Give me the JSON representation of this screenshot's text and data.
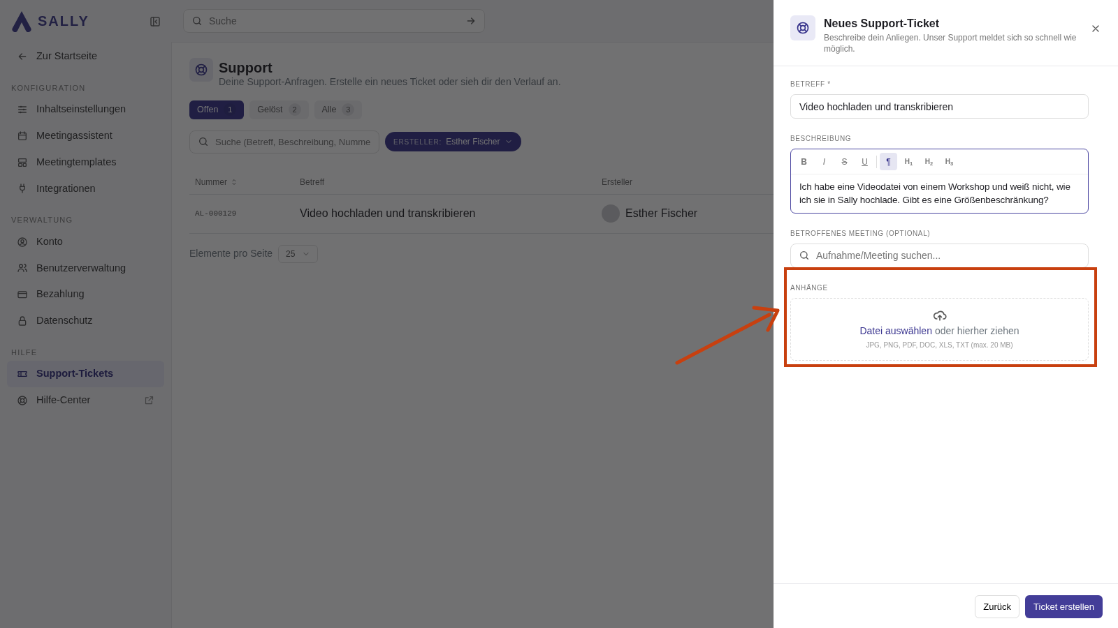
{
  "app": {
    "logo": "SALLY"
  },
  "top_search": {
    "placeholder": "Suche"
  },
  "sidebar": {
    "back_link": "Zur Startseite",
    "sections": [
      {
        "title": "KONFIGURATION",
        "items": [
          {
            "label": "Inhaltseinstellungen",
            "selected": false
          },
          {
            "label": "Meetingassistent",
            "selected": false
          },
          {
            "label": "Meetingtemplates",
            "selected": false
          },
          {
            "label": "Integrationen",
            "selected": false
          }
        ]
      },
      {
        "title": "VERWALTUNG",
        "items": [
          {
            "label": "Konto",
            "selected": false
          },
          {
            "label": "Benutzerverwaltung",
            "selected": false
          },
          {
            "label": "Bezahlung",
            "selected": false
          },
          {
            "label": "Datenschutz",
            "selected": false
          }
        ]
      },
      {
        "title": "HILFE",
        "items": [
          {
            "label": "Support-Tickets",
            "selected": true
          },
          {
            "label": "Hilfe-Center",
            "selected": false,
            "external": true
          }
        ]
      }
    ]
  },
  "page": {
    "title": "Support",
    "subtitle": "Deine Support-Anfragen. Erstelle ein neues Ticket oder sieh dir den Verlauf an.",
    "tabs": [
      {
        "label": "Offen",
        "count": "1",
        "selected": true
      },
      {
        "label": "Gelöst",
        "count": "2",
        "selected": false
      },
      {
        "label": "Alle",
        "count": "3",
        "selected": false
      }
    ],
    "filter_search": {
      "placeholder": "Suche (Betreff, Beschreibung, Numme"
    },
    "filter_chip": {
      "label": "ERSTELLER:",
      "value": "Esther Fischer"
    },
    "table": {
      "columns": [
        "Nummer",
        "Betreff",
        "Ersteller"
      ],
      "rows": [
        {
          "cells": [
            "AL-000129",
            "Video hochladen und transkribieren",
            "Esther Fischer"
          ]
        }
      ]
    },
    "pagination": {
      "label": "Elemente pro Seite",
      "page_size": "25"
    }
  },
  "drawer": {
    "title": "Neues Support-Ticket",
    "subtitle": "Beschreibe dein Anliegen. Unser Support meldet sich so schnell wie möglich.",
    "fields": [
      {
        "kind": "text",
        "label": "BETREFF *",
        "value": "Video hochladen und transkribieren"
      },
      {
        "kind": "editor",
        "label": "BESCHREIBUNG",
        "toolbar": [
          {
            "label": "B",
            "selected": false
          },
          {
            "label": "I",
            "selected": false
          },
          {
            "label": "S",
            "selected": false
          },
          {
            "label": "U",
            "selected": false
          },
          {
            "label": "¶",
            "selected": true
          },
          {
            "label": "H$_{1}$",
            "selected": false
          },
          {
            "label": "H$_{2}$",
            "selected": false
          },
          {
            "label": "H$_{3}$",
            "selected": false
          }
        ],
        "value": "Ich habe eine Videodatei von einem Workshop und weiß nicht, wie ich sie in Sally hochlade. Gibt es eine Größenbeschränkung?"
      },
      {
        "kind": "search",
        "label": "BETROFFENES MEETING (OPTIONAL)",
        "placeholder": "Aufnahme/Meeting suchen..."
      },
      {
        "kind": "upload",
        "label": "ANHÄNGE",
        "link": "Datei auswählen",
        "text": "oder hierher ziehen",
        "hint": "JPG, PNG, PDF, DOC, XLS, TXT (max. 20 MB)",
        "highlighted": true
      }
    ],
    "buttons": [
      {
        "label": "Zurück",
        "kind": "secondary"
      },
      {
        "label": "Ticket erstellen",
        "kind": "primary"
      }
    ]
  }
}
